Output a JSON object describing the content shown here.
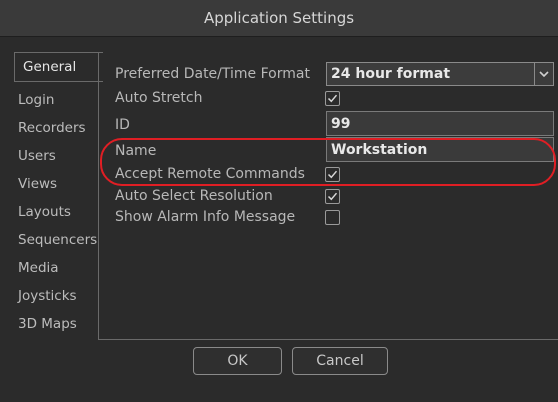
{
  "window": {
    "title": "Application Settings"
  },
  "sidebar": {
    "items": [
      {
        "label": "General",
        "active": true
      },
      {
        "label": "Login"
      },
      {
        "label": "Recorders"
      },
      {
        "label": "Users"
      },
      {
        "label": "Views"
      },
      {
        "label": "Layouts"
      },
      {
        "label": "Sequencers"
      },
      {
        "label": "Media"
      },
      {
        "label": "Joysticks"
      },
      {
        "label": "3D Maps"
      }
    ]
  },
  "general": {
    "date_time_format": {
      "label": "Preferred Date/Time Format",
      "value": "24 hour format"
    },
    "auto_stretch": {
      "label": "Auto Stretch",
      "checked": true
    },
    "id": {
      "label": "ID",
      "value": "99"
    },
    "name": {
      "label": "Name",
      "value": "Workstation"
    },
    "accept_remote": {
      "label": "Accept Remote Commands",
      "checked": true
    },
    "auto_select_resolution": {
      "label": "Auto Select Resolution",
      "checked": true
    },
    "show_alarm_info": {
      "label": "Show Alarm Info Message",
      "checked": false
    }
  },
  "buttons": {
    "ok": "OK",
    "cancel": "Cancel"
  },
  "colors": {
    "highlight": "#e01e24",
    "background": "#2b2b2b"
  }
}
